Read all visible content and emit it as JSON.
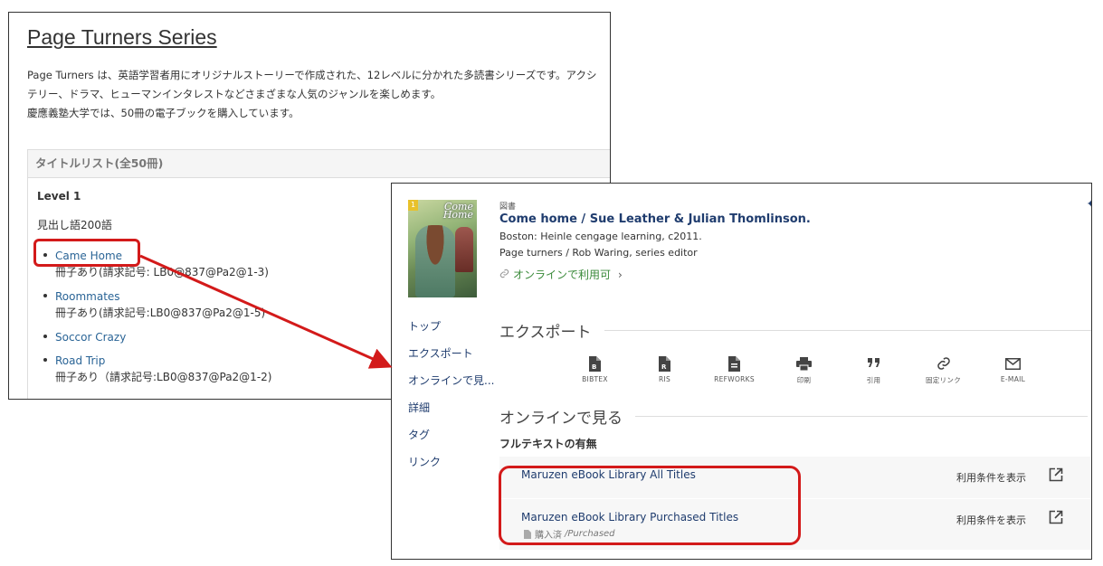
{
  "left": {
    "title": "Page Turners Series",
    "desc_lines": [
      "Page Turners は、英語学習者用にオリジナルストーリーで作成された、12レベルに分かれた多読書シリーズです。アクシ",
      "テリー、ドラマ、ヒューマンインタレストなどさまざまな人気のジャンルを楽しめます。",
      "慶應義塾大学では、50冊の電子ブックを購入しています。"
    ],
    "list_header": "タイトルリスト(全50冊)",
    "level": "Level 1",
    "words": "見出し語200語",
    "items": [
      {
        "title": "Came Home",
        "note": "冊子あり(請求記号: LB0@837@Pa2@1-3)"
      },
      {
        "title": "Roommates",
        "note": "冊子あり(請求記号:LB0@837@Pa2@1-5)"
      },
      {
        "title": "Soccor Crazy",
        "note": ""
      },
      {
        "title": "Road Trip",
        "note": "冊子あり（請求記号:LB0@837@Pa2@1-2)"
      }
    ]
  },
  "right": {
    "cover": {
      "badge": "1",
      "title_line1": "Come",
      "title_line2": "Home"
    },
    "type": "図書",
    "title": "Come home / Sue Leather & Julian Thomlinson.",
    "publisher": "Boston: Heinle cengage learning, c2011.",
    "series": "Page turners / Rob Waring, series editor",
    "online": "オンラインで利用可",
    "nav": [
      "トップ",
      "エクスポート",
      "オンラインで見...",
      "詳細",
      "タグ",
      "リンク"
    ],
    "export_heading": "エクスポート",
    "export_items": [
      {
        "label": "BIBTEX",
        "icon": "file-bibtex-icon"
      },
      {
        "label": "RIS",
        "icon": "file-ris-icon"
      },
      {
        "label": "REFWORKS",
        "icon": "file-refworks-icon"
      },
      {
        "label": "印刷",
        "icon": "printer-icon"
      },
      {
        "label": "引用",
        "icon": "quote-icon"
      },
      {
        "label": "固定リンク",
        "icon": "permalink-icon"
      },
      {
        "label": "E-MAIL",
        "icon": "email-icon"
      }
    ],
    "online_heading": "オンラインで見る",
    "fulltext_label": "フルテキストの有無",
    "fulltext": [
      {
        "name": "Maruzen eBook Library All Titles",
        "terms": "利用条件を表示",
        "sub": "",
        "sub_en": ""
      },
      {
        "name": "Maruzen eBook Library Purchased Titles",
        "terms": "利用条件を表示",
        "sub": "購入済",
        "sub_en": "/Purchased"
      }
    ]
  },
  "colors": {
    "highlight": "#d31a1a",
    "link": "#2a6496",
    "title": "#1f3c6e",
    "online": "#3a8a3a"
  }
}
